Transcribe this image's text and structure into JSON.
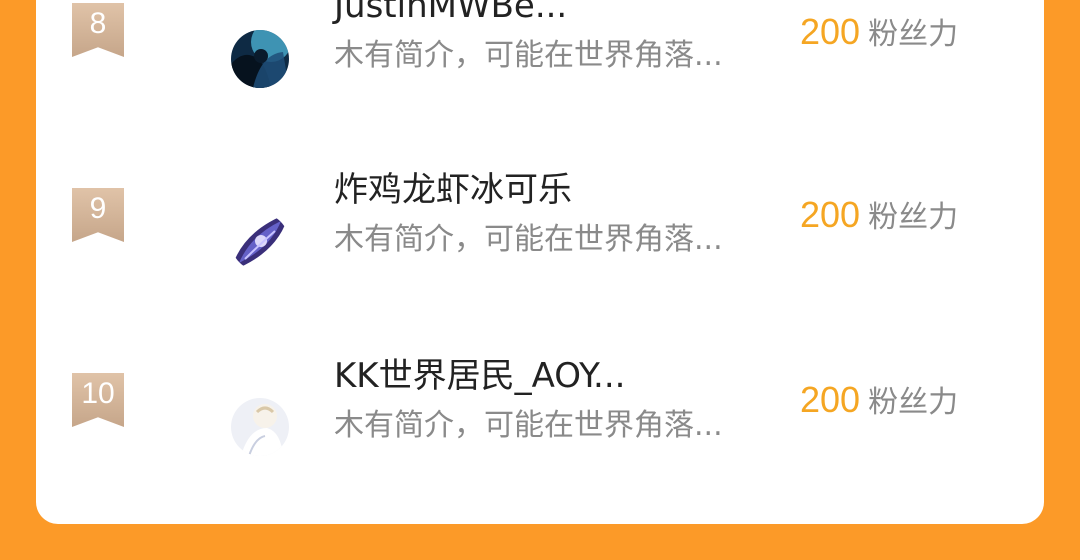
{
  "ranking": {
    "items": [
      {
        "rank": "8",
        "name": "JustinMWBe...",
        "description": "木有简介，可能在世界角落...",
        "fans_value": "200",
        "fans_label": "粉丝力",
        "avatar_icon": "avatar-portrait-dark-blue"
      },
      {
        "rank": "9",
        "name": "炸鸡龙虾冰可乐",
        "description": "木有简介，可能在世界角落...",
        "fans_value": "200",
        "fans_label": "粉丝力",
        "avatar_icon": "avatar-anime-purple"
      },
      {
        "rank": "10",
        "name": "KK世界居民_AOY...",
        "description": "木有简介，可能在世界角落...",
        "fans_value": "200",
        "fans_label": "粉丝力",
        "avatar_icon": "avatar-anime-light"
      }
    ]
  },
  "colors": {
    "background": "#fc9a28",
    "card": "#ffffff",
    "fans_number": "#f5a623",
    "rank_badge": "#d3b598",
    "secondary_text": "#8a8a8a"
  }
}
